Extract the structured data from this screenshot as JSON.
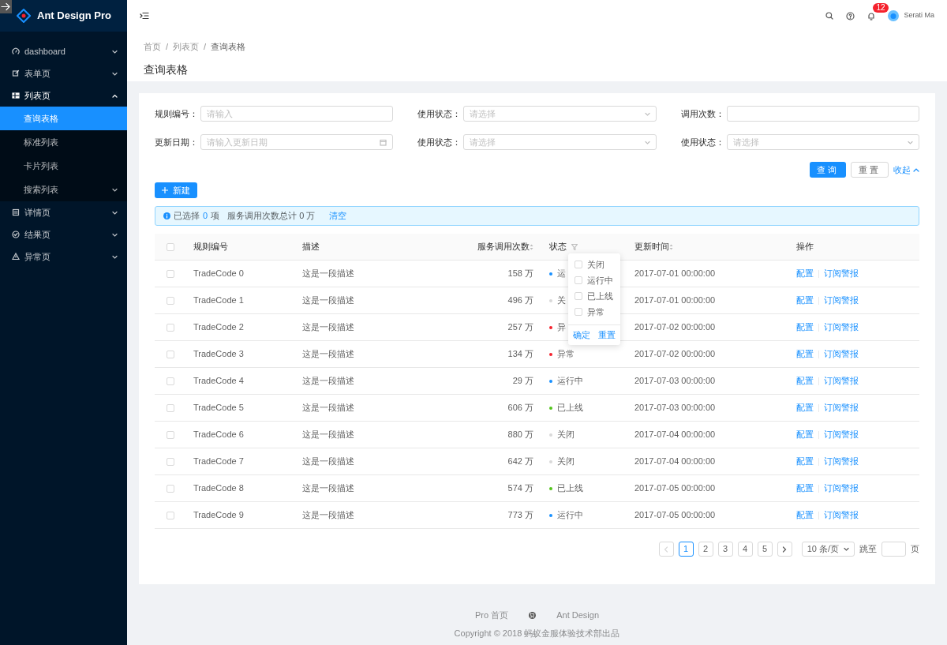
{
  "sidebar": {
    "logo": "Ant Design Pro",
    "items": [
      {
        "label": "dashboard",
        "kind": "submenu",
        "expanded": false,
        "selected": false
      },
      {
        "label": "表单页",
        "kind": "submenu",
        "expanded": false,
        "selected": false
      },
      {
        "label": "列表页",
        "kind": "submenu",
        "expanded": true,
        "selected": false,
        "children": [
          {
            "label": "查询表格",
            "kind": "item",
            "selected": true
          },
          {
            "label": "标准列表",
            "kind": "item",
            "selected": false
          },
          {
            "label": "卡片列表",
            "kind": "item",
            "selected": false
          },
          {
            "label": "搜索列表",
            "kind": "submenu",
            "expanded": false,
            "selected": false
          }
        ]
      },
      {
        "label": "详情页",
        "kind": "submenu",
        "expanded": false,
        "selected": false
      },
      {
        "label": "结果页",
        "kind": "submenu",
        "expanded": false,
        "selected": false
      },
      {
        "label": "异常页",
        "kind": "submenu",
        "expanded": false,
        "selected": false
      }
    ]
  },
  "header": {
    "notification_count": "12",
    "user": "Serati Ma"
  },
  "breadcrumb": {
    "items": [
      "首页",
      "列表页",
      "查询表格"
    ],
    "separator": "/"
  },
  "page_title": "查询表格",
  "filters": [
    {
      "label": "规则编号：",
      "kind": "input",
      "placeholder": "请输入"
    },
    {
      "label": "使用状态：",
      "kind": "select",
      "placeholder": "请选择"
    },
    {
      "label": "调用次数：",
      "kind": "input"
    },
    {
      "label": "更新日期：",
      "kind": "date",
      "placeholder": "请输入更新日期"
    },
    {
      "label": "使用状态：",
      "kind": "select",
      "placeholder": "请选择"
    },
    {
      "label": "使用状态：",
      "kind": "select",
      "placeholder": "请选择"
    }
  ],
  "search_buttons": {
    "submit": "查询",
    "reset": "重置",
    "collapse": "收起"
  },
  "new_button": "新建",
  "alert": {
    "prefix": "已选择",
    "count": "0",
    "suffix": "项",
    "total": "服务调用次数总计 0 万",
    "clear": "清空"
  },
  "table": {
    "select_all": {
      "checked": false
    },
    "columns": [
      {
        "label": "规则编号",
        "sortable": false,
        "filter": false
      },
      {
        "label": "描述",
        "sortable": false,
        "filter": false
      },
      {
        "label": "服务调用次数",
        "sortable": true,
        "filter": false
      },
      {
        "label": "状态",
        "sortable": false,
        "filter": true
      },
      {
        "label": "更新时间",
        "sortable": true,
        "filter": false
      },
      {
        "label": "操作",
        "sortable": false,
        "filter": false
      }
    ],
    "rows": [
      {
        "checked": false,
        "code": "TradeCode 0",
        "desc": "这是一段描述",
        "calls": "158 万",
        "status": "运",
        "color": "#1890ff",
        "time": "2017-07-01 00:00:00",
        "actions": [
          "配置",
          "订阅警报"
        ]
      },
      {
        "checked": false,
        "code": "TradeCode 1",
        "desc": "这是一段描述",
        "calls": "496 万",
        "status": "关",
        "color": "#d9d9d9",
        "time": "2017-07-01 00:00:00",
        "actions": [
          "配置",
          "订阅警报"
        ]
      },
      {
        "checked": false,
        "code": "TradeCode 2",
        "desc": "这是一段描述",
        "calls": "257 万",
        "status": "异",
        "color": "#f5222d",
        "time": "2017-07-02 00:00:00",
        "actions": [
          "配置",
          "订阅警报"
        ]
      },
      {
        "checked": false,
        "code": "TradeCode 3",
        "desc": "这是一段描述",
        "calls": "134 万",
        "status": "异常",
        "color": "#f5222d",
        "time": "2017-07-02 00:00:00",
        "actions": [
          "配置",
          "订阅警报"
        ]
      },
      {
        "checked": false,
        "code": "TradeCode 4",
        "desc": "这是一段描述",
        "calls": "29 万",
        "status": "运行中",
        "color": "#1890ff",
        "time": "2017-07-03 00:00:00",
        "actions": [
          "配置",
          "订阅警报"
        ]
      },
      {
        "checked": false,
        "code": "TradeCode 5",
        "desc": "这是一段描述",
        "calls": "606 万",
        "status": "已上线",
        "color": "#52c41a",
        "time": "2017-07-03 00:00:00",
        "actions": [
          "配置",
          "订阅警报"
        ]
      },
      {
        "checked": false,
        "code": "TradeCode 6",
        "desc": "这是一段描述",
        "calls": "880 万",
        "status": "关闭",
        "color": "#d9d9d9",
        "time": "2017-07-04 00:00:00",
        "actions": [
          "配置",
          "订阅警报"
        ]
      },
      {
        "checked": false,
        "code": "TradeCode 7",
        "desc": "这是一段描述",
        "calls": "642 万",
        "status": "关闭",
        "color": "#d9d9d9",
        "time": "2017-07-04 00:00:00",
        "actions": [
          "配置",
          "订阅警报"
        ]
      },
      {
        "checked": false,
        "code": "TradeCode 8",
        "desc": "这是一段描述",
        "calls": "574 万",
        "status": "已上线",
        "color": "#52c41a",
        "time": "2017-07-05 00:00:00",
        "actions": [
          "配置",
          "订阅警报"
        ]
      },
      {
        "checked": false,
        "code": "TradeCode 9",
        "desc": "这是一段描述",
        "calls": "773 万",
        "status": "运行中",
        "color": "#1890ff",
        "time": "2017-07-05 00:00:00",
        "actions": [
          "配置",
          "订阅警报"
        ]
      }
    ]
  },
  "filter_dropdown": {
    "options": [
      {
        "label": "关闭",
        "checked": false
      },
      {
        "label": "运行中",
        "checked": false
      },
      {
        "label": "已上线",
        "checked": false
      },
      {
        "label": "异常",
        "checked": false
      }
    ],
    "confirm": "确定",
    "reset": "重置"
  },
  "pagination": {
    "prev_disabled": true,
    "next_disabled": false,
    "pages": [
      {
        "label": "1",
        "selected": true
      },
      {
        "label": "2",
        "selected": false
      },
      {
        "label": "3",
        "selected": false
      },
      {
        "label": "4",
        "selected": false
      },
      {
        "label": "5",
        "selected": false
      }
    ],
    "page_size": "10 条/页",
    "jump_label": "跳至",
    "jump_suffix": "页"
  },
  "footer": {
    "links": [
      "Pro 首页",
      "Ant Design"
    ],
    "copyright": "Copyright © 2018 蚂蚁金服体验技术部出品"
  }
}
